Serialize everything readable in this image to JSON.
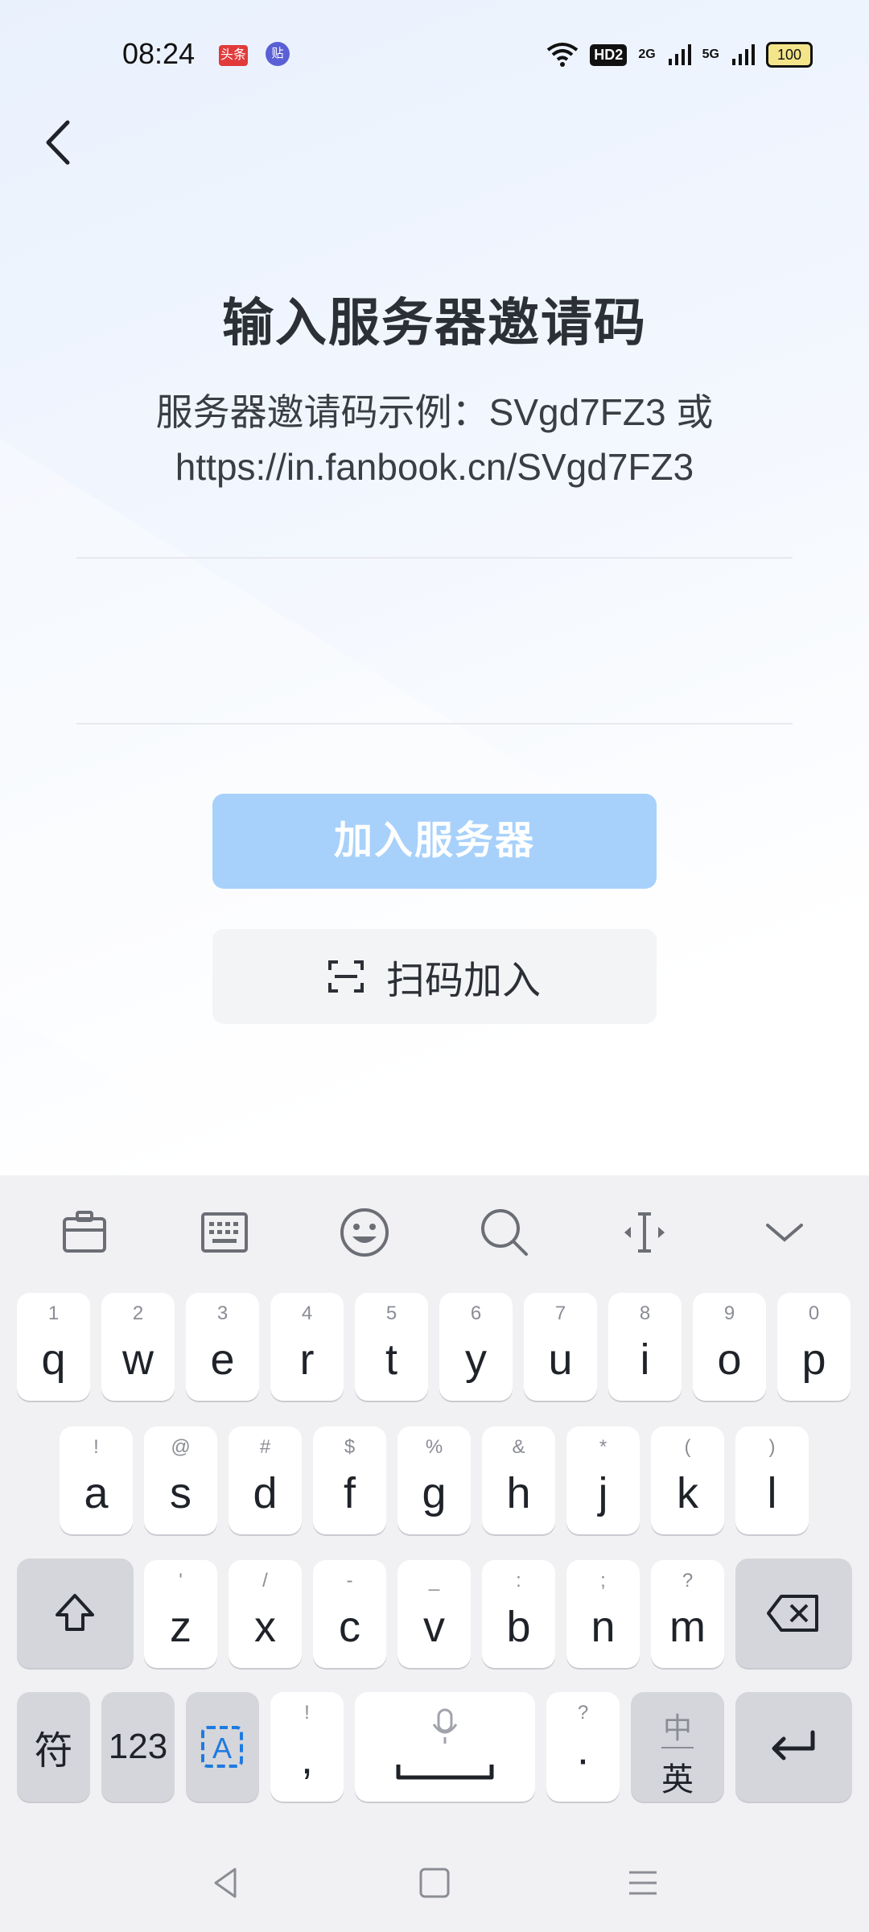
{
  "status_bar": {
    "time": "08:24",
    "app_badges": [
      "头条",
      "贴"
    ],
    "network": [
      "HD2",
      "2G",
      "5G"
    ],
    "battery": "100"
  },
  "header": {
    "back_icon": "chevron-left-icon"
  },
  "content": {
    "title": "输入服务器邀请码",
    "description_line1": "服务器邀请码示例：SVgd7FZ3 或",
    "description_line2": "https://in.fanbook.cn/SVgd7FZ3",
    "input_value": "",
    "join_button": "加入服务器",
    "scan_button": "扫码加入",
    "colors": {
      "primary_disabled": "#a7d1fb",
      "secondary_bg": "#f3f4f6"
    }
  },
  "keyboard": {
    "toolbar_icons": [
      "clipboard-icon",
      "keyboard-icon",
      "emoji-icon",
      "search-icon",
      "cursor-icon",
      "collapse-icon"
    ],
    "row1": [
      {
        "sub": "1",
        "main": "q"
      },
      {
        "sub": "2",
        "main": "w"
      },
      {
        "sub": "3",
        "main": "e"
      },
      {
        "sub": "4",
        "main": "r"
      },
      {
        "sub": "5",
        "main": "t"
      },
      {
        "sub": "6",
        "main": "y"
      },
      {
        "sub": "7",
        "main": "u"
      },
      {
        "sub": "8",
        "main": "i"
      },
      {
        "sub": "9",
        "main": "o"
      },
      {
        "sub": "0",
        "main": "p"
      }
    ],
    "row2": [
      {
        "sub": "!",
        "main": "a"
      },
      {
        "sub": "@",
        "main": "s"
      },
      {
        "sub": "#",
        "main": "d"
      },
      {
        "sub": "$",
        "main": "f"
      },
      {
        "sub": "%",
        "main": "g"
      },
      {
        "sub": "&",
        "main": "h"
      },
      {
        "sub": "*",
        "main": "j"
      },
      {
        "sub": "(",
        "main": "k"
      },
      {
        "sub": ")",
        "main": "l"
      }
    ],
    "row3": [
      {
        "sub": "'",
        "main": "z"
      },
      {
        "sub": "/",
        "main": "x"
      },
      {
        "sub": "-",
        "main": "c"
      },
      {
        "sub": "_",
        "main": "v"
      },
      {
        "sub": ":",
        "main": "b"
      },
      {
        "sub": ";",
        "main": "n"
      },
      {
        "sub": "?",
        "main": "m"
      }
    ],
    "symbols_key": "符",
    "numbers_key": "123",
    "comma_sub": "!",
    "comma_main": ",",
    "period_sub": "?",
    "period_main": "·",
    "lang_top": "中",
    "lang_bottom": "英"
  }
}
